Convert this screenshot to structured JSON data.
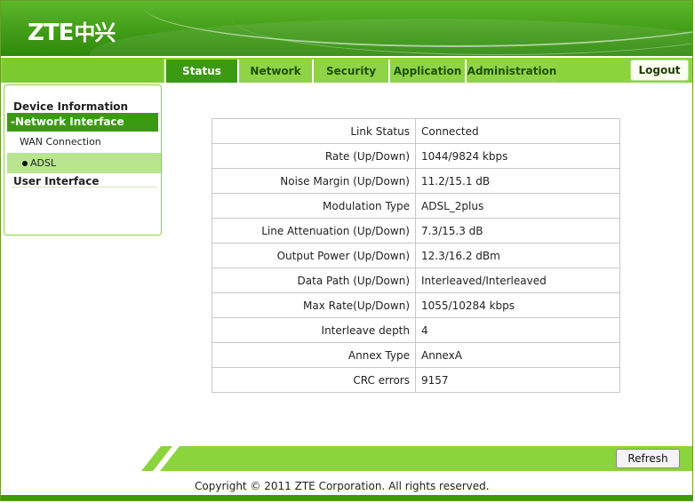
{
  "brand": {
    "logo_text": "ZTE",
    "logo_mark": "中兴",
    "primary_color": "#3b9a12",
    "light_color": "#8bd43c"
  },
  "nav": {
    "tabs": [
      {
        "label": "Status",
        "active": true
      },
      {
        "label": "Network",
        "active": false
      },
      {
        "label": "Security",
        "active": false
      },
      {
        "label": "Application",
        "active": false
      },
      {
        "label": "Administration",
        "active": false
      }
    ],
    "logout_label": "Logout"
  },
  "sidebar": {
    "device_information": "Device Information",
    "network_interface": "-Network Interface",
    "wan_connection": "WAN Connection",
    "adsl": "ADSL",
    "user_interface": "User Interface"
  },
  "adsl_status": {
    "rows": [
      {
        "label": "Link Status",
        "value": "Connected"
      },
      {
        "label": "Rate (Up/Down)",
        "value": "1044/9824 kbps"
      },
      {
        "label": "Noise Margin (Up/Down)",
        "value": "11.2/15.1 dB"
      },
      {
        "label": "Modulation Type",
        "value": "ADSL_2plus"
      },
      {
        "label": "Line Attenuation (Up/Down)",
        "value": "7.3/15.3 dB"
      },
      {
        "label": "Output Power (Up/Down)",
        "value": "12.3/16.2 dBm"
      },
      {
        "label": "Data Path (Up/Down)",
        "value": "Interleaved/Interleaved"
      },
      {
        "label": "Max Rate(Up/Down)",
        "value": "1055/10284 kbps"
      },
      {
        "label": "Interleave depth",
        "value": "4"
      },
      {
        "label": "Annex Type",
        "value": "AnnexA"
      },
      {
        "label": "CRC errors",
        "value": "9157"
      }
    ]
  },
  "footer": {
    "refresh_label": "Refresh",
    "copyright": "Copyright © 2011 ZTE Corporation. All rights reserved."
  }
}
